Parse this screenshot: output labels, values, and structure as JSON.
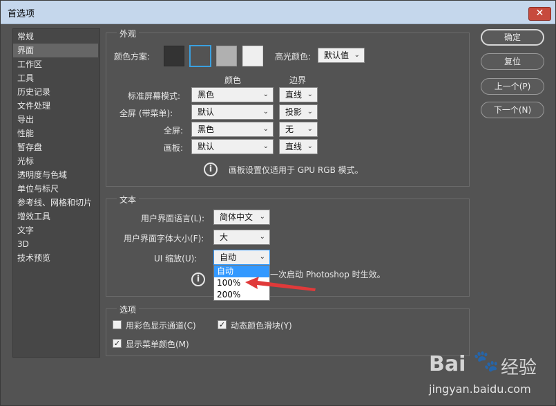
{
  "window": {
    "title": "首选项",
    "close": "✕"
  },
  "sidebar": {
    "items": [
      {
        "label": "常规"
      },
      {
        "label": "界面"
      },
      {
        "label": "工作区"
      },
      {
        "label": "工具"
      },
      {
        "label": "历史记录"
      },
      {
        "label": "文件处理"
      },
      {
        "label": "导出"
      },
      {
        "label": "性能"
      },
      {
        "label": "暂存盘"
      },
      {
        "label": "光标"
      },
      {
        "label": "透明度与色域"
      },
      {
        "label": "单位与标尺"
      },
      {
        "label": "参考线、网格和切片"
      },
      {
        "label": "增效工具"
      },
      {
        "label": "文字"
      },
      {
        "label": "3D"
      },
      {
        "label": "技术预览"
      }
    ]
  },
  "appearance": {
    "title": "外观",
    "color_scheme_label": "颜色方案:",
    "swatches": [
      "#333333",
      "#535353",
      "#b0b0b0",
      "#efefef"
    ],
    "highlight_label": "高光颜色:",
    "highlight_value": "默认值",
    "col_color": "颜色",
    "col_border": "边界",
    "rows": [
      {
        "label": "标准屏幕模式:",
        "color": "黑色",
        "border": "直线"
      },
      {
        "label": "全屏 (带菜单):",
        "color": "默认",
        "border": "投影"
      },
      {
        "label": "全屏:",
        "color": "黑色",
        "border": "无"
      },
      {
        "label": "画板:",
        "color": "默认",
        "border": "直线"
      }
    ],
    "note": "画板设置仅适用于 GPU RGB 模式。"
  },
  "text": {
    "title": "文本",
    "ui_language_label": "用户界面语言(L):",
    "ui_language_value": "简体中文",
    "ui_font_size_label": "用户界面字体大小(F):",
    "ui_font_size_value": "大",
    "ui_scale_label": "UI 缩放(U):",
    "ui_scale_value": "自动",
    "ui_scale_options": [
      "自动",
      "100%",
      "200%"
    ],
    "note": "一次启动 Photoshop 时生效。"
  },
  "options": {
    "title": "选项",
    "color_channels": "用彩色显示通道(C)",
    "color_channels_checked": false,
    "dynamic_sliders": "动态颜色滑块(Y)",
    "dynamic_sliders_checked": true,
    "menu_colors": "显示菜单颜色(M)",
    "menu_colors_checked": true
  },
  "buttons": {
    "ok": "确定",
    "reset": "复位",
    "prev": "上一个(P)",
    "next": "下一个(N)"
  },
  "watermark": {
    "brand": "Bai",
    "brand2": "经验",
    "url": "jingyan.baidu.com"
  },
  "colors": {
    "accent": "#3399ff",
    "arrow": "#e03a3a"
  }
}
